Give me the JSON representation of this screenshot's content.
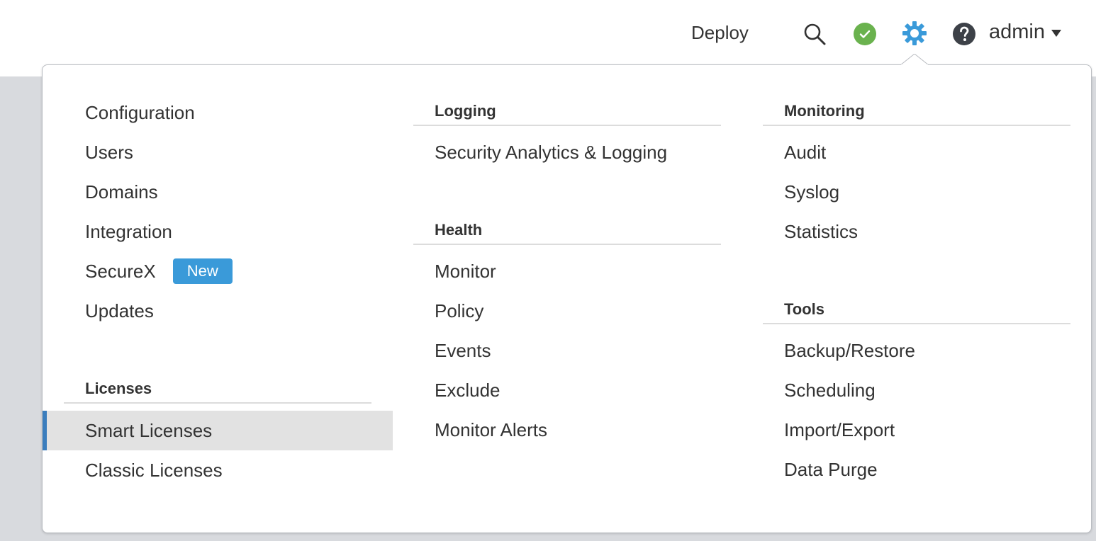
{
  "header": {
    "deploy_label": "Deploy",
    "username": "admin"
  },
  "icons": {
    "search": "search-icon",
    "status": "status-ok-icon",
    "settings": "gear-icon",
    "help": "help-icon",
    "caret": "caret-down-icon"
  },
  "colors": {
    "accent": "#3a9ad9",
    "selected_bg": "#e2e2e2",
    "selected_bar": "#3a7dbd",
    "status_ok": "#6ab24e",
    "help_bg": "#3d4148"
  },
  "menu": {
    "column1": {
      "items": [
        "Configuration",
        "Users",
        "Domains",
        "Integration",
        "SecureX",
        "Updates"
      ],
      "securex_badge": "New",
      "licenses_title": "Licenses",
      "licenses_items": [
        "Smart Licenses",
        "Classic Licenses"
      ],
      "selected": "Smart Licenses"
    },
    "column2": {
      "logging_title": "Logging",
      "logging_items": [
        "Security Analytics & Logging"
      ],
      "health_title": "Health",
      "health_items": [
        "Monitor",
        "Policy",
        "Events",
        "Exclude",
        "Monitor Alerts"
      ]
    },
    "column3": {
      "monitoring_title": "Monitoring",
      "monitoring_items": [
        "Audit",
        "Syslog",
        "Statistics"
      ],
      "tools_title": "Tools",
      "tools_items": [
        "Backup/Restore",
        "Scheduling",
        "Import/Export",
        "Data Purge"
      ]
    }
  }
}
